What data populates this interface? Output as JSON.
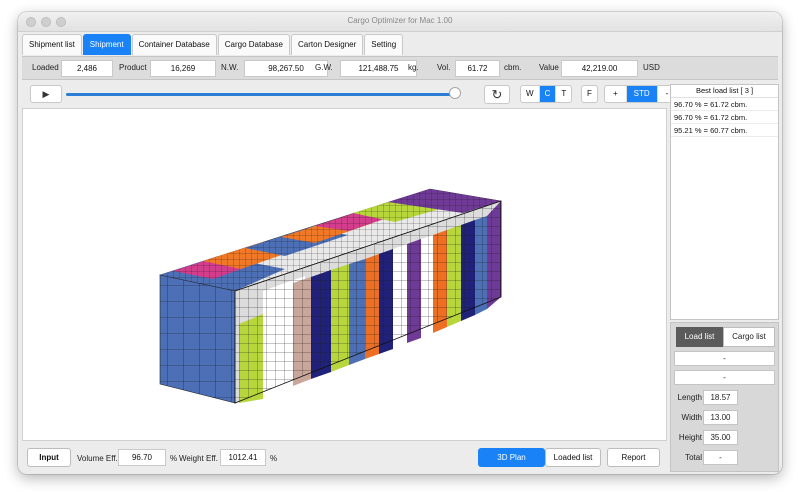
{
  "window": {
    "title": "Cargo Optimizer for Mac 1.00"
  },
  "tabs": [
    "Shipment list",
    "Shipment",
    "Container Database",
    "Cargo Database",
    "Carton Designer",
    "Setting"
  ],
  "info": {
    "loaded_label": "Loaded",
    "loaded": "2,486",
    "product_label": "Product",
    "product": "16,269",
    "nw_label": "N.W.",
    "nw": "98,267.50",
    "gw_label": "G.W.",
    "gw": "121,488.75",
    "gw_unit": "kg.",
    "vol_label": "Vol.",
    "vol": "61.72",
    "vol_unit": "cbm.",
    "value_label": "Value",
    "value": "42,219.00",
    "value_unit": "USD"
  },
  "toolbar": {
    "play": "▶",
    "refresh": "↻",
    "view_buttons": [
      "W",
      "C",
      "T"
    ],
    "f_button": "F",
    "zoom_buttons": [
      "+",
      "STD",
      "-"
    ]
  },
  "best_load": {
    "header": "Best load list [ 3 ]",
    "rows": [
      "96.70 % = 61.72 cbm.",
      "96.70 % = 61.72 cbm.",
      "95.21 % = 60.77 cbm."
    ]
  },
  "panel": {
    "load_list_tab": "Load list",
    "cargo_list_tab": "Cargo list",
    "dash1": "-",
    "dash2": "-",
    "length_label": "Length",
    "length": "18.57",
    "width_label": "Width",
    "width": "13.00",
    "height_label": "Height",
    "height": "35.00",
    "total_label": "Total",
    "total": "-"
  },
  "bottom": {
    "input": "Input",
    "vol_eff_label": "Volume Eff.",
    "vol_eff": "96.70",
    "vol_unit": "%",
    "weight_eff_label": "Weight Eff.",
    "weight_eff": "1012.41",
    "weight_unit": "%",
    "plan3d": "3D Plan",
    "loaded_list": "Loaded list",
    "report": "Report"
  },
  "colors": {
    "accent": "#1a82f7",
    "slider": "#2a7fd4",
    "cargo": [
      "#4c6fb6",
      "#f07826",
      "#b7d63c",
      "#d23d8c",
      "#1f2278",
      "#6f3a96",
      "#dcdcdc",
      "#c9a69a",
      "#ffffff",
      "#49c1c8",
      "#ed6f23"
    ]
  }
}
